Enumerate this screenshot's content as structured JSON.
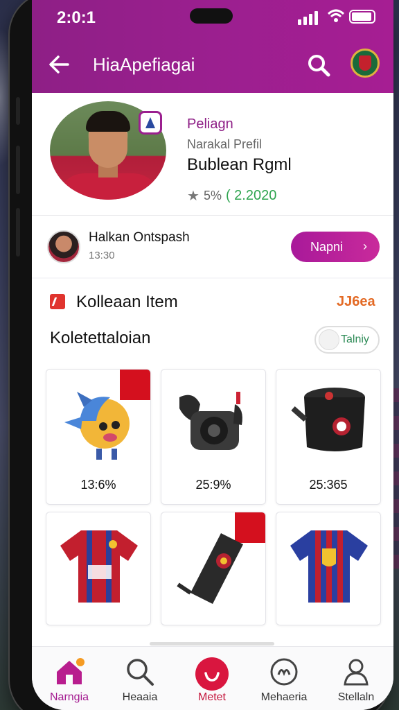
{
  "status": {
    "time": "2:0:1"
  },
  "appbar": {
    "title": "HiaApefiagai"
  },
  "profile": {
    "kicker": "Peliagn",
    "sub": "Narakal Prefil",
    "name": "Bublean Rgml",
    "rating_text": "5%",
    "rating_score": "( 2.2020",
    "seller_name": "Halkan Ontspash",
    "seller_time": "13:30",
    "action_label": "Napni"
  },
  "collection": {
    "title": "Kolleaan Item",
    "count": "JJ6ea",
    "subtitle": "Koletettaloian",
    "toggle_label": "Talniy",
    "items": [
      {
        "price": "13:6%",
        "icon": "mascot-figure-icon"
      },
      {
        "price": "25:9%",
        "icon": "camera-icon"
      },
      {
        "price": "25:365",
        "icon": "bag-icon"
      },
      {
        "price": "",
        "icon": "jersey-icon"
      },
      {
        "price": "",
        "icon": "scarf-icon"
      },
      {
        "price": "",
        "icon": "jersey-icon"
      }
    ]
  },
  "nav": [
    {
      "label": "Narngia",
      "icon": "home-icon",
      "active": true
    },
    {
      "label": "Heaaia",
      "icon": "search-icon",
      "active": false
    },
    {
      "label": "Metet",
      "icon": "chat-icon",
      "active": false
    },
    {
      "label": "Mehaeria",
      "icon": "clock-icon",
      "active": false
    },
    {
      "label": "Stellaln",
      "icon": "profile-icon",
      "active": false
    }
  ],
  "colors": {
    "brand": "#9b1f8f",
    "accent": "#c92a9b",
    "count": "#e36a25",
    "score": "#2ea44f"
  }
}
